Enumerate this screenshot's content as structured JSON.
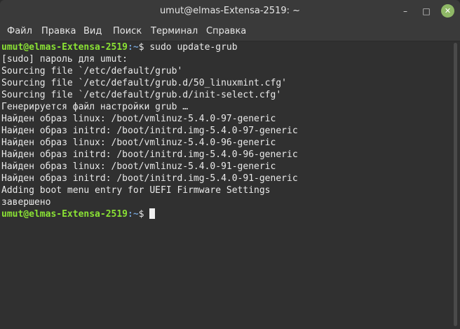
{
  "window": {
    "title": "umut@elmas-Extensa-2519: ~",
    "controls": {
      "minimize": "–",
      "maximize": "□",
      "close": "✕"
    }
  },
  "menu": {
    "items": [
      "Файл",
      "Правка",
      "Вид",
      "Поиск",
      "Терминал",
      "Справка"
    ]
  },
  "terminal": {
    "prompt_user": "umut@elmas-Extensa-2519",
    "prompt_path": ":~",
    "prompt_symbol": "$ ",
    "command": "sudo update-grub",
    "output": [
      "[sudo] пароль для umut:",
      "Sourcing file `/etc/default/grub'",
      "Sourcing file `/etc/default/grub.d/50_linuxmint.cfg'",
      "Sourcing file `/etc/default/grub.d/init-select.cfg'",
      "Генерируется файл настройки grub …",
      "Найден образ linux: /boot/vmlinuz-5.4.0-97-generic",
      "Найден образ initrd: /boot/initrd.img-5.4.0-97-generic",
      "Найден образ linux: /boot/vmlinuz-5.4.0-96-generic",
      "Найден образ initrd: /boot/initrd.img-5.4.0-96-generic",
      "Найден образ linux: /boot/vmlinuz-5.4.0-91-generic",
      "Найден образ initrd: /boot/initrd.img-5.4.0-91-generic",
      "Adding boot menu entry for UEFI Firmware Settings",
      "завершено"
    ]
  },
  "colors": {
    "prompt_user": "#8ae234",
    "prompt_path": "#729fcf",
    "close_button": "#8fb866"
  }
}
